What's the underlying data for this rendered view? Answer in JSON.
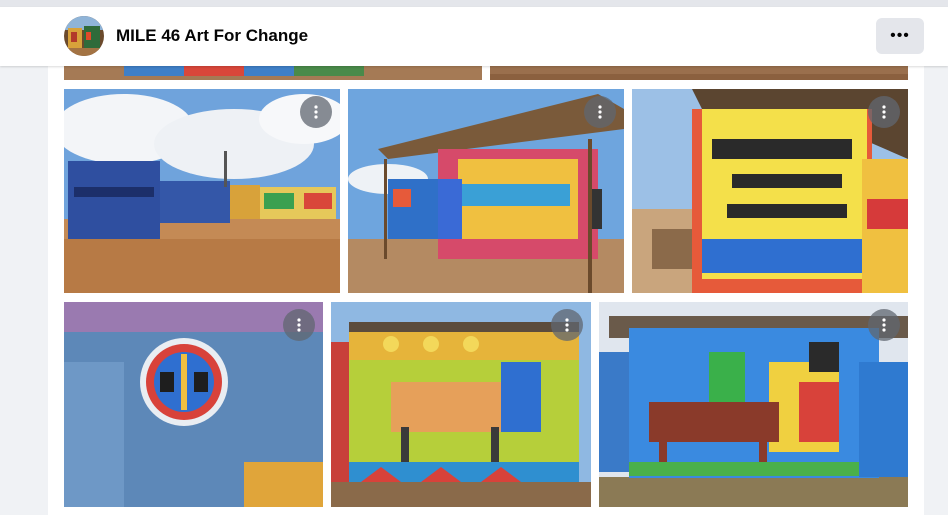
{
  "page": {
    "title": "MILE 46 Art For Change",
    "avatar_icon": "profile-avatar",
    "more_icon": "more-horizontal-icon",
    "more_label": "•••"
  },
  "photos": {
    "count_visible": 8,
    "item_menu_icon": "more-vertical-icon"
  }
}
